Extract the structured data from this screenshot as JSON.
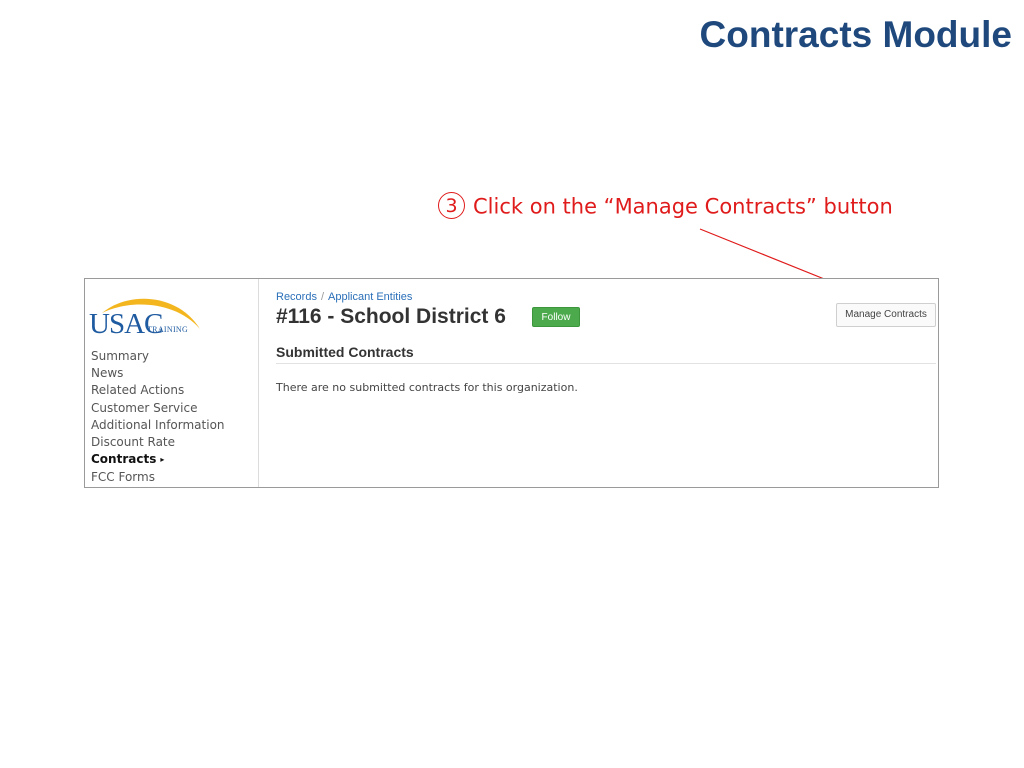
{
  "slide": {
    "title": "Contracts Module",
    "instruction": {
      "step": "3",
      "text": "Click on the “Manage Contracts” button"
    },
    "annotation_color": "#e01b1b",
    "title_color": "#1f497d"
  },
  "logo": {
    "brand": "USAC",
    "suffix": "TRAINING",
    "arc_color": "#f3b61f",
    "text_color": "#1f5ba0"
  },
  "sidebar": {
    "items": [
      {
        "label": "Summary",
        "active": false
      },
      {
        "label": "News",
        "active": false
      },
      {
        "label": "Related Actions",
        "active": false
      },
      {
        "label": "Customer Service",
        "active": false
      },
      {
        "label": "Additional Information",
        "active": false
      },
      {
        "label": "Discount Rate",
        "active": false
      },
      {
        "label": "Contracts",
        "active": true,
        "caret": "▸"
      },
      {
        "label": "FCC Forms",
        "active": false
      }
    ]
  },
  "breadcrumb": {
    "items": [
      "Records",
      "Applicant Entities"
    ],
    "separator": "/"
  },
  "record": {
    "title": "#116 - School District 6",
    "follow_label": "Follow",
    "follow_color": "#4caa4c"
  },
  "toolbar": {
    "manage_contracts_label": "Manage Contracts"
  },
  "section": {
    "title": "Submitted Contracts",
    "empty_message": "There are no submitted contracts for this organization."
  }
}
